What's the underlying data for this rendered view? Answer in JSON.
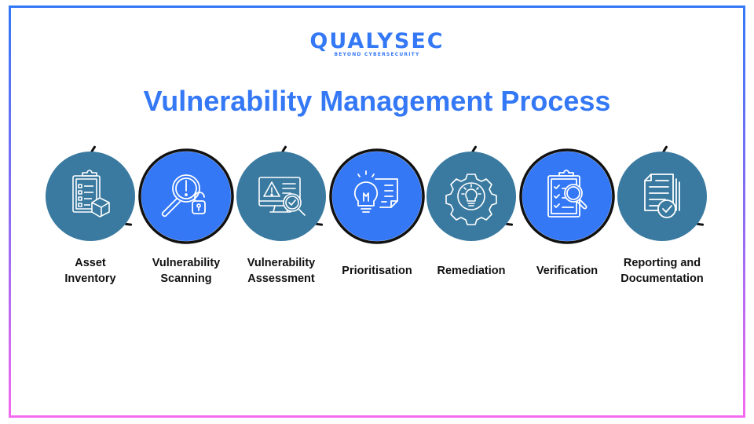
{
  "logo": {
    "name": "QUALYSEC",
    "tagline": "BEYOND CYBERSECURITY"
  },
  "title": "Vulnerability Management Process",
  "colors": {
    "teal": "#3A7AA0",
    "blue": "#3478F6",
    "ring": "#111111",
    "title": "#3478F6"
  },
  "steps": [
    {
      "label": "Asset Inventory",
      "lines": [
        "Asset",
        "Inventory"
      ],
      "icon": "clipboard-box-icon",
      "color": "teal"
    },
    {
      "label": "Vulnerability Scanning",
      "lines": [
        "Vulnerability",
        "Scanning"
      ],
      "icon": "magnifier-unlock-icon",
      "color": "blue"
    },
    {
      "label": "Vulnerability Assessment",
      "lines": [
        "Vulnerability",
        "Assessment"
      ],
      "icon": "monitor-warning-icon",
      "color": "teal"
    },
    {
      "label": "Prioritisation",
      "lines": [
        "Prioritisation"
      ],
      "icon": "lightbulb-note-icon",
      "color": "blue"
    },
    {
      "label": "Remediation",
      "lines": [
        "Remediation"
      ],
      "icon": "gear-bulb-icon",
      "color": "teal"
    },
    {
      "label": "Verification",
      "lines": [
        "Verification"
      ],
      "icon": "clipboard-search-icon",
      "color": "blue"
    },
    {
      "label": "Reporting and Documentation",
      "lines": [
        "Reporting and",
        "Documentation"
      ],
      "icon": "documents-check-icon",
      "color": "teal"
    }
  ]
}
